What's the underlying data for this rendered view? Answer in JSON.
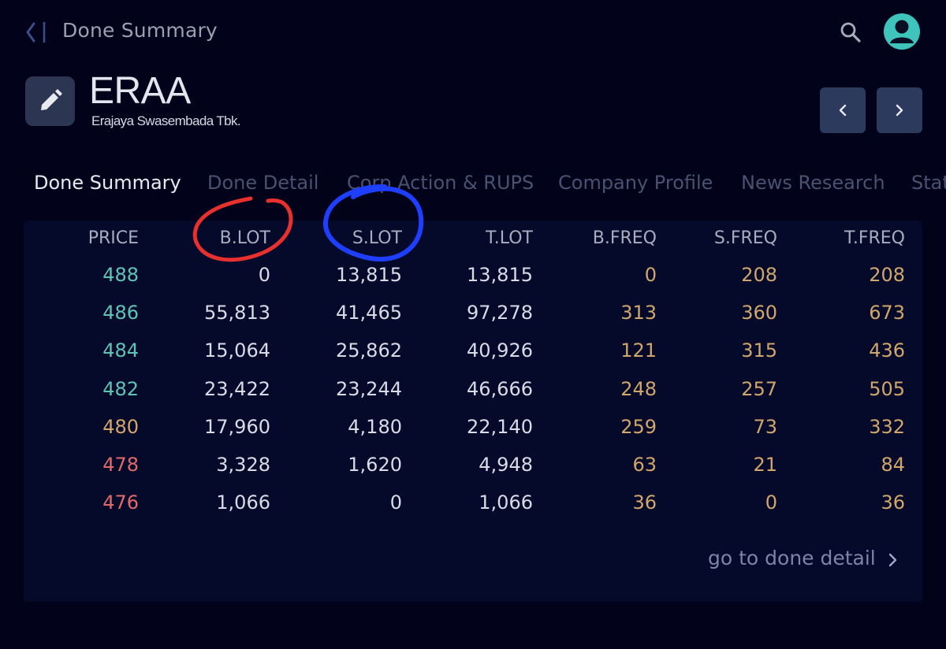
{
  "topbar": {
    "title": "Done Summary",
    "back_icon": "chevron-left-icon",
    "search_icon": "search-icon",
    "avatar_icon": "user-avatar-icon"
  },
  "header": {
    "ticker": "ERAA",
    "company_name": "Erajaya Swasembada Tbk.",
    "edit_icon": "pencil-icon",
    "prev_icon": "chevron-left-icon",
    "next_icon": "chevron-right-icon"
  },
  "tabs": [
    {
      "label": "Done Summary",
      "active": true
    },
    {
      "label": "Done Detail",
      "active": false
    },
    {
      "label": "Corp Action & RUPS",
      "active": false
    },
    {
      "label": "Company Profile",
      "active": false
    },
    {
      "label": "News Research",
      "active": false
    },
    {
      "label": "Stat",
      "active": false
    }
  ],
  "table": {
    "columns": [
      "PRICE",
      "B.LOT",
      "S.LOT",
      "T.LOT",
      "B.FREQ",
      "S.FREQ",
      "T.FREQ"
    ],
    "rows": [
      {
        "price": "488",
        "b_lot": "0",
        "s_lot": "13,815",
        "t_lot": "13,815",
        "b_freq": "0",
        "s_freq": "208",
        "t_freq": "208",
        "price_status": "up"
      },
      {
        "price": "486",
        "b_lot": "55,813",
        "s_lot": "41,465",
        "t_lot": "97,278",
        "b_freq": "313",
        "s_freq": "360",
        "t_freq": "673",
        "price_status": "up"
      },
      {
        "price": "484",
        "b_lot": "15,064",
        "s_lot": "25,862",
        "t_lot": "40,926",
        "b_freq": "121",
        "s_freq": "315",
        "t_freq": "436",
        "price_status": "up"
      },
      {
        "price": "482",
        "b_lot": "23,422",
        "s_lot": "23,244",
        "t_lot": "46,666",
        "b_freq": "248",
        "s_freq": "257",
        "t_freq": "505",
        "price_status": "up"
      },
      {
        "price": "480",
        "b_lot": "17,960",
        "s_lot": "4,180",
        "t_lot": "22,140",
        "b_freq": "259",
        "s_freq": "73",
        "t_freq": "332",
        "price_status": "unchanged"
      },
      {
        "price": "478",
        "b_lot": "3,328",
        "s_lot": "1,620",
        "t_lot": "4,948",
        "b_freq": "63",
        "s_freq": "21",
        "t_freq": "84",
        "price_status": "down"
      },
      {
        "price": "476",
        "b_lot": "1,066",
        "s_lot": "0",
        "t_lot": "1,066",
        "b_freq": "36",
        "s_freq": "0",
        "t_freq": "36",
        "price_status": "down"
      }
    ]
  },
  "footer": {
    "link_label": "go to done detail",
    "link_icon": "chevron-right-icon"
  },
  "annotations": [
    {
      "target": "B.LOT",
      "color": "#e8302f"
    },
    {
      "target": "S.LOT",
      "color": "#1f3fff"
    }
  ],
  "colors": {
    "background": "#02031a",
    "panel": "#05092a",
    "price_up": "#5ec4b6",
    "price_unchanged": "#d1a66c",
    "price_down": "#e06a6a",
    "freq": "#d1a66c",
    "avatar": "#3ec4bb"
  }
}
